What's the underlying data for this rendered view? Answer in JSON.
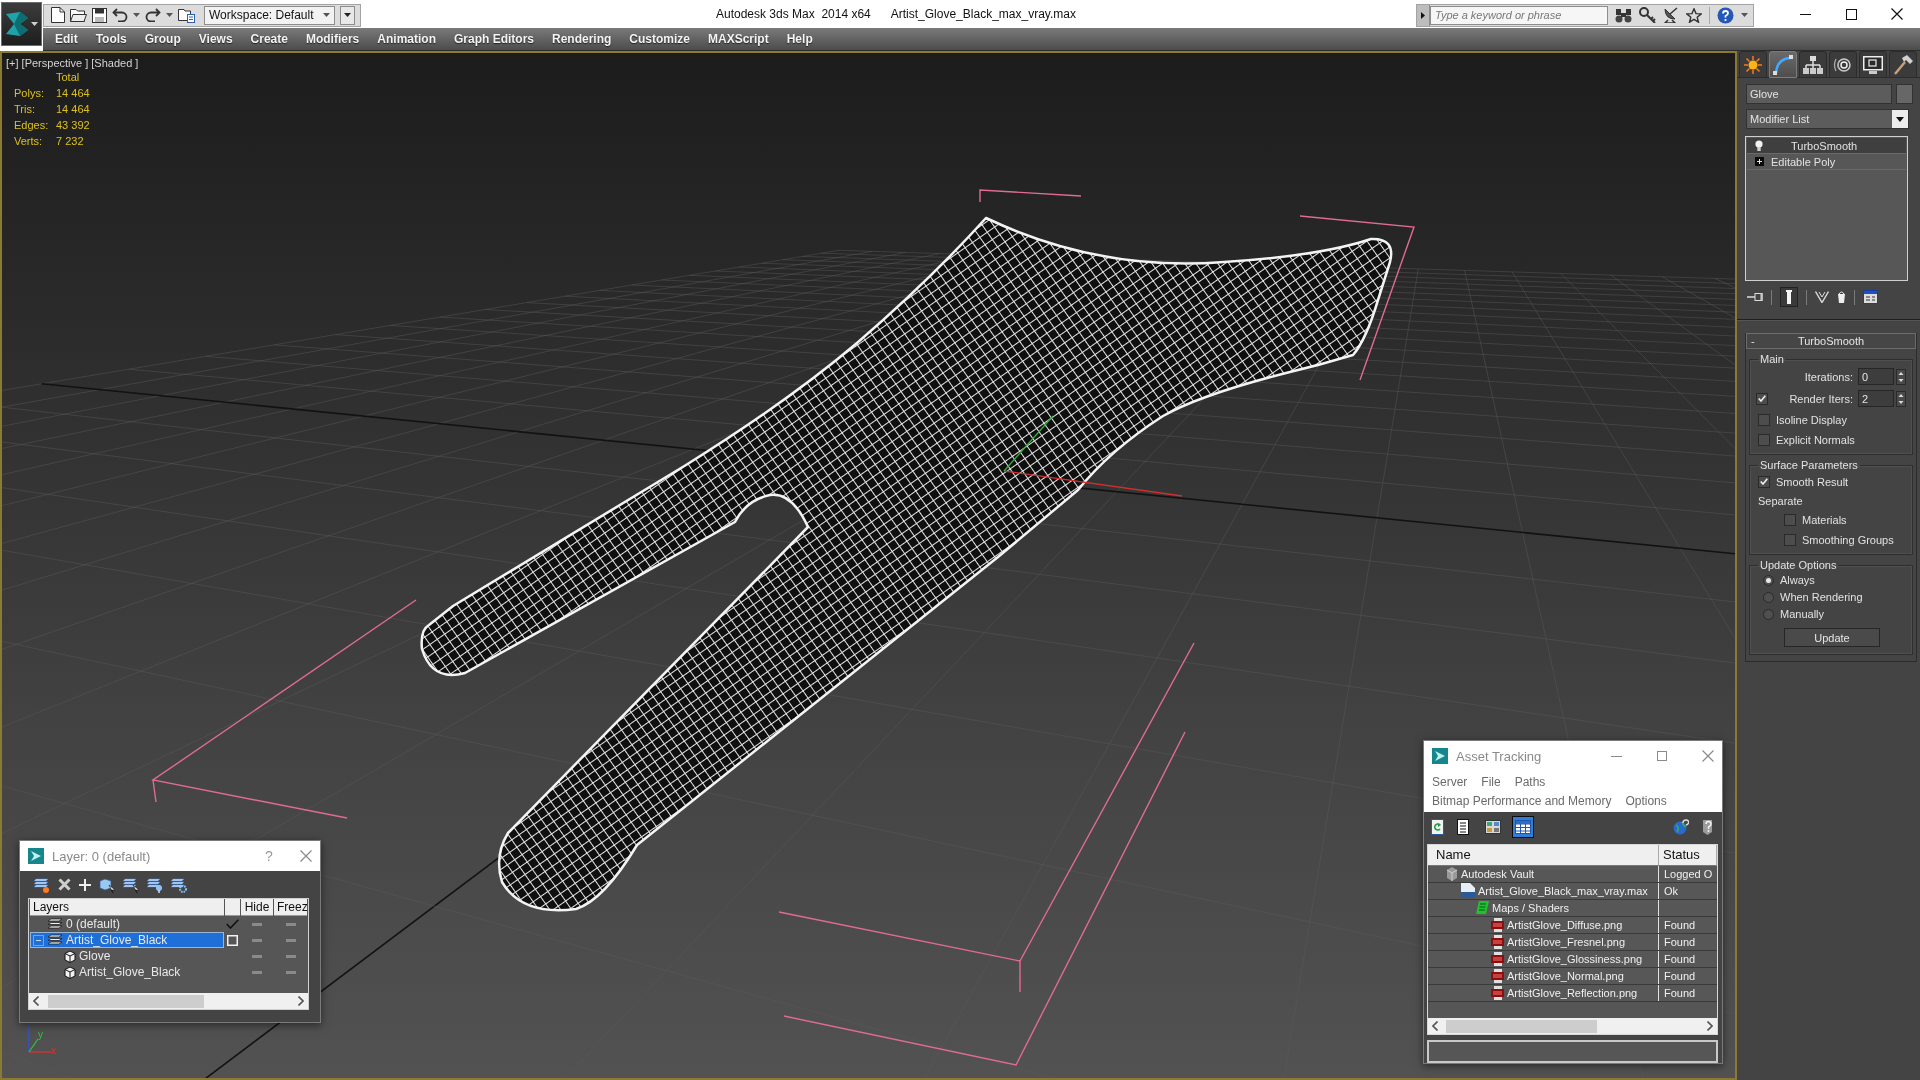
{
  "title_bar": {
    "workspace": "Workspace: Default",
    "app_title": "Autodesk 3ds Max  2014 x64",
    "file_name": "Artist_Glove_Black_max_vray.max",
    "search": {
      "placeholder": "Type a keyword or phrase"
    }
  },
  "menu_bar": [
    "Edit",
    "Tools",
    "Group",
    "Views",
    "Create",
    "Modifiers",
    "Animation",
    "Graph Editors",
    "Rendering",
    "Customize",
    "MAXScript",
    "Help"
  ],
  "viewport": {
    "label": "[+] [Perspective ] [Shaded ]",
    "active": true,
    "stats": {
      "header": "Total",
      "rows": [
        {
          "label": "Polys:",
          "value": "14 464"
        },
        {
          "label": "Tris:",
          "value": "14 464"
        },
        {
          "label": "Edges:",
          "value": "43 392"
        },
        {
          "label": "Verts:",
          "value": "7 232"
        }
      ]
    },
    "axis_tripod": {
      "x_label": "x",
      "y_label": "y"
    }
  },
  "command_panel": {
    "tabs": [
      {
        "kind": "create",
        "selected": false
      },
      {
        "kind": "modify",
        "selected": true
      },
      {
        "kind": "hierarchy",
        "selected": false
      },
      {
        "kind": "motion",
        "selected": false
      },
      {
        "kind": "display",
        "selected": false
      },
      {
        "kind": "utilities",
        "selected": false
      }
    ],
    "object_name": "Glove",
    "modifier_list": "Modifier List",
    "stack": [
      {
        "name": "TurboSmooth",
        "kind": "modifier",
        "selected": true
      },
      {
        "name": "Editable Poly",
        "kind": "base",
        "selected": false
      }
    ],
    "stack_tools": {
      "show_end_result": true
    },
    "rollout": {
      "toggle": "-",
      "title": "TurboSmooth",
      "groups": [
        {
          "title": "Main",
          "controls": [
            {
              "kind": "spinner",
              "label": "Iterations:",
              "value": "0"
            },
            {
              "kind": "spinner",
              "label": "Render Iters:",
              "value": "2",
              "checked": true
            },
            {
              "kind": "checkbox",
              "label": "Isoline Display",
              "checked": false
            },
            {
              "kind": "checkbox",
              "label": "Explicit Normals",
              "checked": false
            }
          ]
        },
        {
          "title": "Surface Parameters",
          "controls": [
            {
              "kind": "checkbox",
              "label": "Smooth Result",
              "checked": true
            },
            {
              "kind": "label",
              "label": "Separate",
              "children": [
                {
                  "kind": "checkbox",
                  "label": "Materials",
                  "checked": false
                },
                {
                  "kind": "checkbox",
                  "label": "Smoothing Groups",
                  "checked": false
                }
              ]
            }
          ]
        },
        {
          "title": "Update Options",
          "controls": [
            {
              "kind": "radio",
              "label": "Always",
              "selected": true
            },
            {
              "kind": "radio",
              "label": "When Rendering",
              "selected": false
            },
            {
              "kind": "radio",
              "label": "Manually",
              "selected": false
            },
            {
              "kind": "button",
              "label": "Update"
            }
          ]
        }
      ]
    }
  },
  "layer_dialog": {
    "title": "Layer: 0 (default)",
    "help": "?",
    "columns": [
      "Layers",
      "Hide",
      "Freez"
    ],
    "rows": [
      {
        "name": "0 (default)",
        "kind": "layer",
        "selected": false,
        "current": true,
        "hidden": false,
        "frozen": false
      },
      {
        "name": "Artist_Glove_Black",
        "kind": "layer",
        "selected": true,
        "current": false,
        "expanded": true,
        "hidden": false,
        "frozen": false,
        "children": [
          {
            "name": "Glove",
            "kind": "object",
            "selected": false,
            "hidden": false,
            "frozen": false
          },
          {
            "name": "Artist_Glove_Black",
            "kind": "object",
            "selected": false,
            "hidden": false,
            "frozen": false
          }
        ]
      }
    ]
  },
  "asset_tracking": {
    "title": "Asset Tracking",
    "menu_rows": [
      [
        "Server",
        "File",
        "Paths"
      ],
      [
        "Bitmap Performance and Memory",
        "Options"
      ]
    ],
    "view_modes": [
      {
        "kind": "list",
        "selected": false
      },
      {
        "kind": "thumbnails",
        "selected": false
      },
      {
        "kind": "table",
        "selected": true
      }
    ],
    "columns": [
      "Name",
      "Status"
    ],
    "rows": [
      {
        "name": "Autodesk Vault",
        "kind": "vault",
        "status": "Logged O",
        "selected": false,
        "children": [
          {
            "name": "Artist_Glove_Black_max_vray.max",
            "kind": "scene",
            "status": "Ok",
            "selected": false,
            "children": [
              {
                "name": "Maps / Shaders",
                "kind": "folder",
                "selected": false,
                "children": [
                  {
                    "name": "ArtistGlove_Diffuse.png",
                    "kind": "image",
                    "status": "Found",
                    "selected": false
                  },
                  {
                    "name": "ArtistGlove_Fresnel.png",
                    "kind": "image",
                    "status": "Found",
                    "selected": false
                  },
                  {
                    "name": "ArtistGlove_Glossiness.png",
                    "kind": "image",
                    "status": "Found",
                    "selected": false
                  },
                  {
                    "name": "ArtistGlove_Normal.png",
                    "kind": "image",
                    "status": "Found",
                    "selected": false
                  },
                  {
                    "name": "ArtistGlove_Reflection.png",
                    "kind": "image",
                    "status": "Found",
                    "selected": false
                  }
                ]
              }
            ]
          }
        ]
      }
    ]
  }
}
